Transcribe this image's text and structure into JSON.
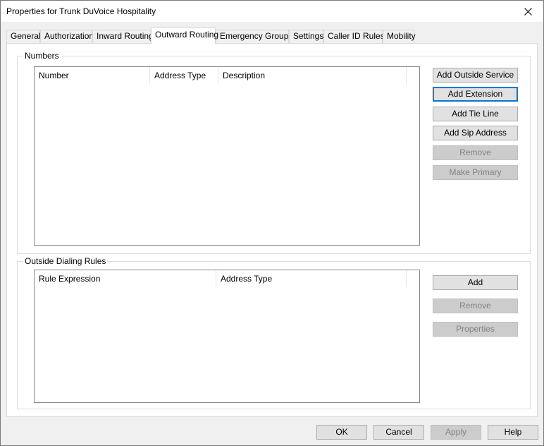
{
  "window": {
    "title": "Properties for Trunk DuVoice Hospitality"
  },
  "tabs": [
    {
      "label": "General"
    },
    {
      "label": "Authorization"
    },
    {
      "label": "Inward Routing"
    },
    {
      "label": "Outward Routing"
    },
    {
      "label": "Emergency Groups"
    },
    {
      "label": "Settings"
    },
    {
      "label": "Caller ID Rules"
    },
    {
      "label": "Mobility"
    }
  ],
  "active_tab": "Outward Routing",
  "numbers": {
    "group_label": "Numbers",
    "columns": [
      "Number",
      "Address Type",
      "Description"
    ],
    "buttons": {
      "add_outside_service": "Add Outside Service",
      "add_extension": "Add Extension",
      "add_tie_line": "Add Tie Line",
      "add_sip_address": "Add Sip Address",
      "remove": "Remove",
      "make_primary": "Make Primary"
    }
  },
  "dialing_rules": {
    "group_label": "Outside Dialing Rules",
    "columns": [
      "Rule Expression",
      "Address Type"
    ],
    "buttons": {
      "add": "Add",
      "remove": "Remove",
      "properties": "Properties"
    }
  },
  "footer": {
    "ok": "OK",
    "cancel": "Cancel",
    "apply": "Apply",
    "help": "Help"
  }
}
